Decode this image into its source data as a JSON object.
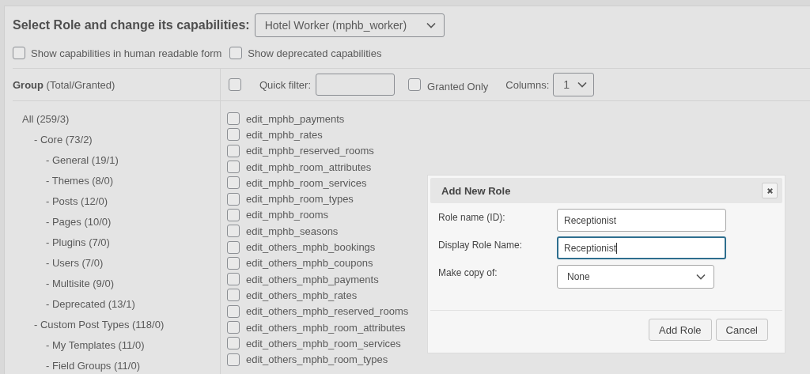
{
  "role_select": {
    "label": "Select Role and change its capabilities:",
    "value": "Hotel Worker (mphb_worker)"
  },
  "options": [
    {
      "label": "Show capabilities in human readable form",
      "checked": false
    },
    {
      "label": "Show deprecated capabilities",
      "checked": false
    }
  ],
  "groups": {
    "heading": "Group",
    "subheading": "(Total/Granted)",
    "tree": [
      {
        "label": "All (259/3)",
        "children": [
          {
            "label": "- Core (73/2)",
            "children": [
              {
                "label": "- General (19/1)"
              },
              {
                "label": "- Themes (8/0)"
              },
              {
                "label": "- Posts (12/0)"
              },
              {
                "label": "- Pages (10/0)"
              },
              {
                "label": "- Plugins (7/0)"
              },
              {
                "label": "- Users (7/0)"
              },
              {
                "label": "- Multisite (9/0)"
              },
              {
                "label": "- Deprecated (13/1)"
              }
            ]
          },
          {
            "label": "- Custom Post Types (118/0)",
            "children": [
              {
                "label": "- My Templates (11/0)"
              },
              {
                "label": "- Field Groups (11/0)"
              }
            ]
          }
        ]
      }
    ]
  },
  "toolbar": {
    "select_all_checked": false,
    "quick_filter_label": "Quick filter:",
    "granted_only": {
      "label": "Granted Only",
      "checked": false
    },
    "columns_label": "Columns:",
    "columns_value": "1"
  },
  "capabilities": [
    {
      "name": "edit_mphb_payments",
      "checked": false
    },
    {
      "name": "edit_mphb_rates",
      "checked": false
    },
    {
      "name": "edit_mphb_reserved_rooms",
      "checked": false
    },
    {
      "name": "edit_mphb_room_attributes",
      "checked": false
    },
    {
      "name": "edit_mphb_room_services",
      "checked": false
    },
    {
      "name": "edit_mphb_room_types",
      "checked": false
    },
    {
      "name": "edit_mphb_rooms",
      "checked": false
    },
    {
      "name": "edit_mphb_seasons",
      "checked": false
    },
    {
      "name": "edit_others_mphb_bookings",
      "checked": false
    },
    {
      "name": "edit_others_mphb_coupons",
      "checked": false
    },
    {
      "name": "edit_others_mphb_payments",
      "checked": false
    },
    {
      "name": "edit_others_mphb_rates",
      "checked": false
    },
    {
      "name": "edit_others_mphb_reserved_rooms",
      "checked": false
    },
    {
      "name": "edit_others_mphb_room_attributes",
      "checked": false
    },
    {
      "name": "edit_others_mphb_room_services",
      "checked": false
    },
    {
      "name": "edit_others_mphb_room_types",
      "checked": false
    }
  ],
  "dialog": {
    "title": "Add New Role",
    "fields": [
      {
        "kind": "text",
        "label": "Role name (ID):",
        "value": "Receptionist",
        "focused": false
      },
      {
        "kind": "text",
        "label": "Display Role Name:",
        "value": "Receptionist",
        "focused": true
      },
      {
        "kind": "select",
        "label": "Make copy of:",
        "value": "None",
        "focused": false
      }
    ],
    "buttons": [
      "Add Role",
      "Cancel"
    ]
  }
}
